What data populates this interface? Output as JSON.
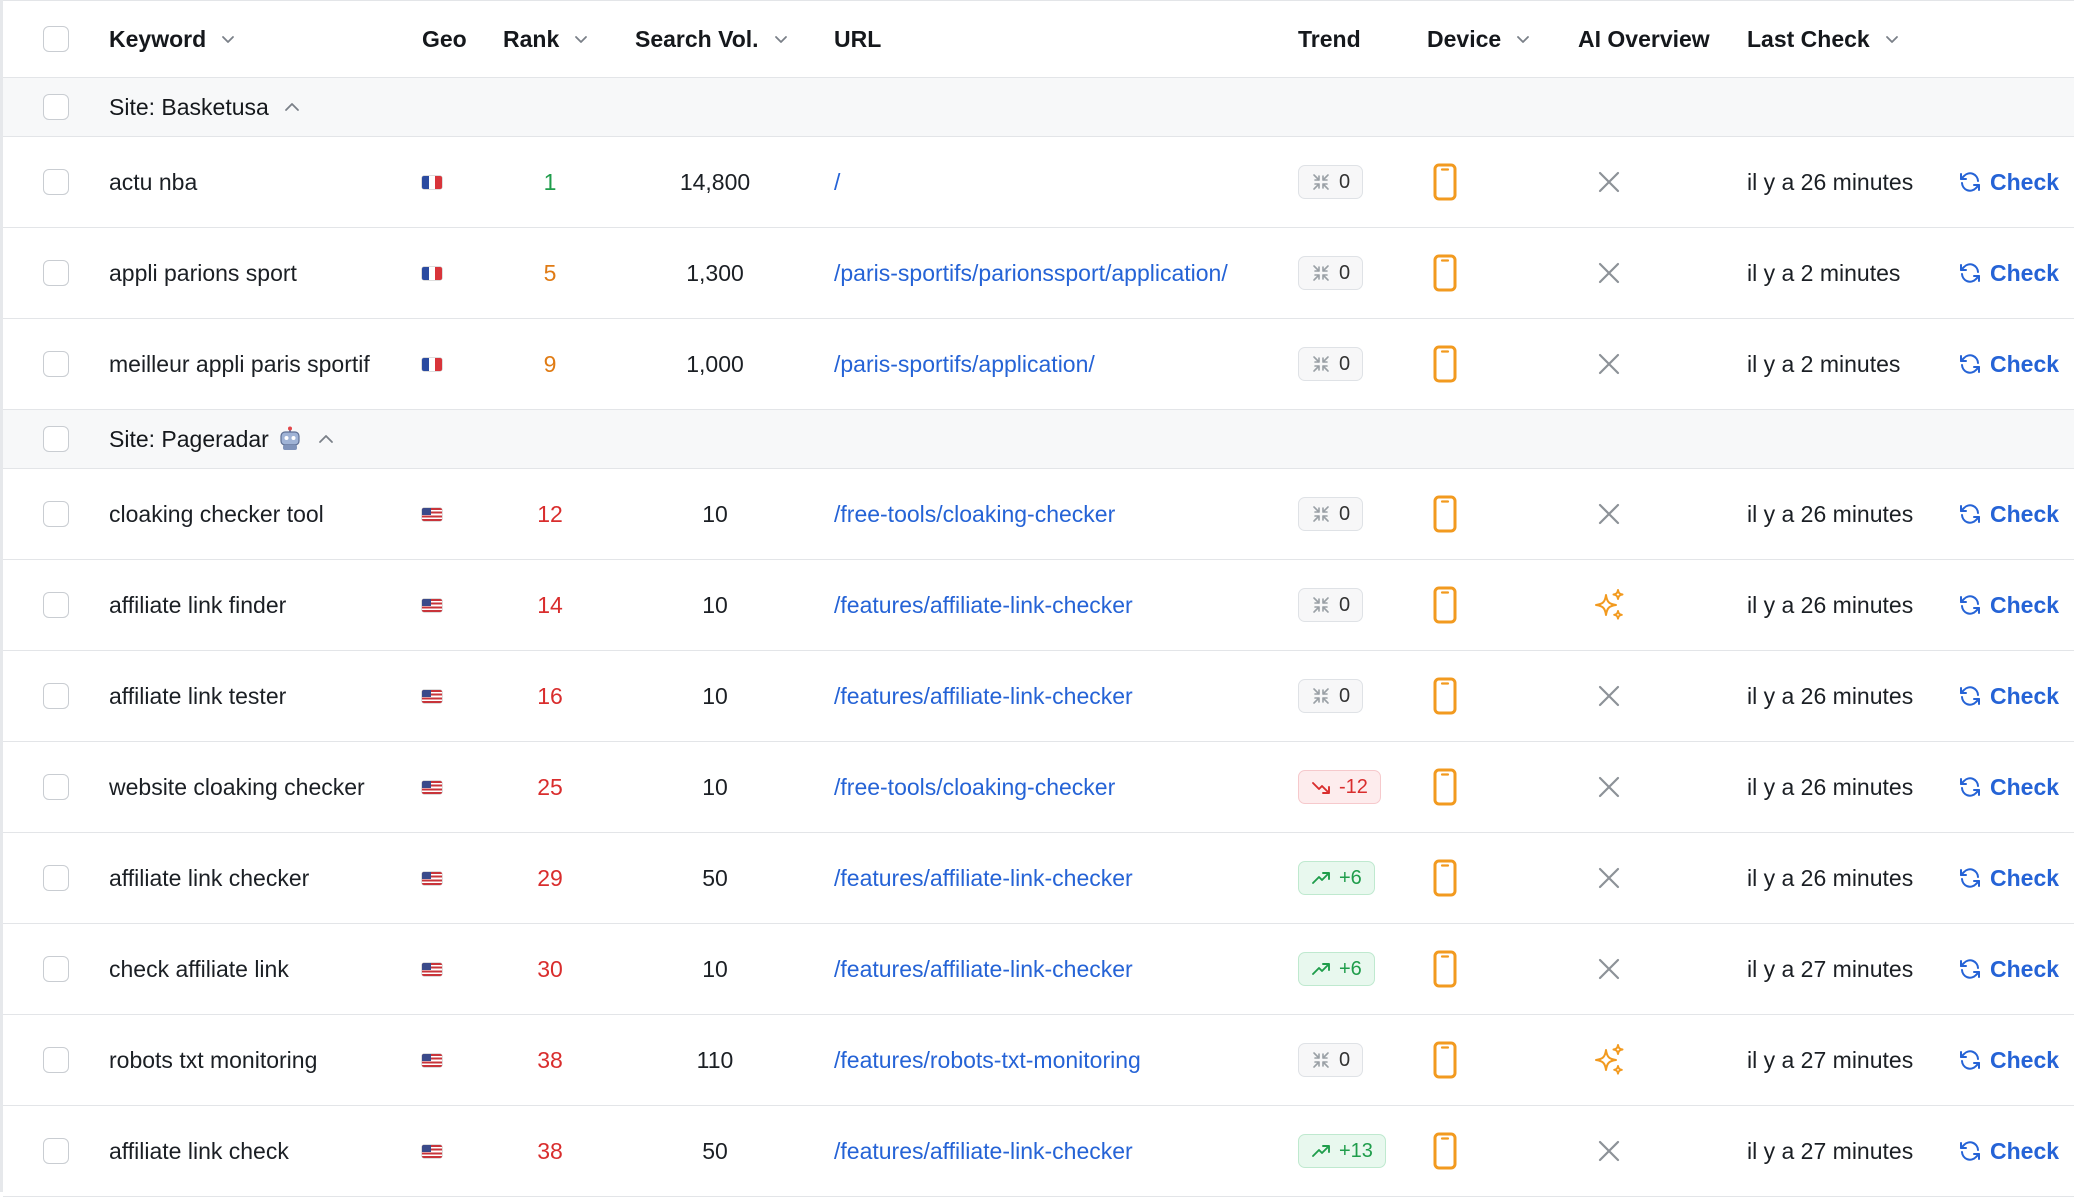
{
  "columns": {
    "keyword": "Keyword",
    "geo": "Geo",
    "rank": "Rank",
    "search_vol": "Search Vol.",
    "url": "URL",
    "trend": "Trend",
    "device": "Device",
    "ai_overview": "AI Overview",
    "last_check": "Last Check"
  },
  "check_label": "Check",
  "colors": {
    "link_blue": "#2563d6",
    "rank_green": "#1f9d4b",
    "rank_orange": "#e07b14",
    "rank_red": "#d92d2d",
    "device_orange": "#f29a1f"
  },
  "groups": [
    {
      "label": "Site: Basketusa",
      "rows": [
        {
          "keyword": "actu nba",
          "geo": "fr",
          "rank": "1",
          "rank_tone": "green",
          "volume": "14,800",
          "url": "/",
          "trend": "0",
          "trend_type": "flat",
          "ai": "none",
          "last_check": "il y a 26 minutes"
        },
        {
          "keyword": "appli parions sport",
          "geo": "fr",
          "rank": "5",
          "rank_tone": "orange",
          "volume": "1,300",
          "url": "/paris-sportifs/parionssport/application/",
          "trend": "0",
          "trend_type": "flat",
          "ai": "none",
          "last_check": "il y a 2 minutes"
        },
        {
          "keyword": "meilleur appli paris sportif",
          "geo": "fr",
          "rank": "9",
          "rank_tone": "orange",
          "volume": "1,000",
          "url": "/paris-sportifs/application/",
          "trend": "0",
          "trend_type": "flat",
          "ai": "none",
          "last_check": "il y a 2 minutes"
        }
      ]
    },
    {
      "label": "Site: Pageradar",
      "rows": [
        {
          "keyword": "cloaking checker tool",
          "geo": "us",
          "rank": "12",
          "rank_tone": "red",
          "volume": "10",
          "url": "/free-tools/cloaking-checker",
          "trend": "0",
          "trend_type": "flat",
          "ai": "none",
          "last_check": "il y a 26 minutes"
        },
        {
          "keyword": "affiliate link finder",
          "geo": "us",
          "rank": "14",
          "rank_tone": "red",
          "volume": "10",
          "url": "/features/affiliate-link-checker",
          "trend": "0",
          "trend_type": "flat",
          "ai": "sparkle",
          "last_check": "il y a 26 minutes"
        },
        {
          "keyword": "affiliate link tester",
          "geo": "us",
          "rank": "16",
          "rank_tone": "red",
          "volume": "10",
          "url": "/features/affiliate-link-checker",
          "trend": "0",
          "trend_type": "flat",
          "ai": "none",
          "last_check": "il y a 26 minutes"
        },
        {
          "keyword": "website cloaking checker",
          "geo": "us",
          "rank": "25",
          "rank_tone": "red",
          "volume": "10",
          "url": "/free-tools/cloaking-checker",
          "trend": "-12",
          "trend_type": "down",
          "ai": "none",
          "last_check": "il y a 26 minutes"
        },
        {
          "keyword": "affiliate link checker",
          "geo": "us",
          "rank": "29",
          "rank_tone": "red",
          "volume": "50",
          "url": "/features/affiliate-link-checker",
          "trend": "+6",
          "trend_type": "up",
          "ai": "none",
          "last_check": "il y a 26 minutes"
        },
        {
          "keyword": "check affiliate link",
          "geo": "us",
          "rank": "30",
          "rank_tone": "red",
          "volume": "10",
          "url": "/features/affiliate-link-checker",
          "trend": "+6",
          "trend_type": "up",
          "ai": "none",
          "last_check": "il y a 27 minutes"
        },
        {
          "keyword": "robots txt monitoring",
          "geo": "us",
          "rank": "38",
          "rank_tone": "red",
          "volume": "110",
          "url": "/features/robots-txt-monitoring",
          "trend": "0",
          "trend_type": "flat",
          "ai": "sparkle",
          "last_check": "il y a 27 minutes"
        },
        {
          "keyword": "affiliate link check",
          "geo": "us",
          "rank": "38",
          "rank_tone": "red",
          "volume": "50",
          "url": "/features/affiliate-link-checker",
          "trend": "+13",
          "trend_type": "up",
          "ai": "none",
          "last_check": "il y a 27 minutes"
        }
      ]
    }
  ]
}
